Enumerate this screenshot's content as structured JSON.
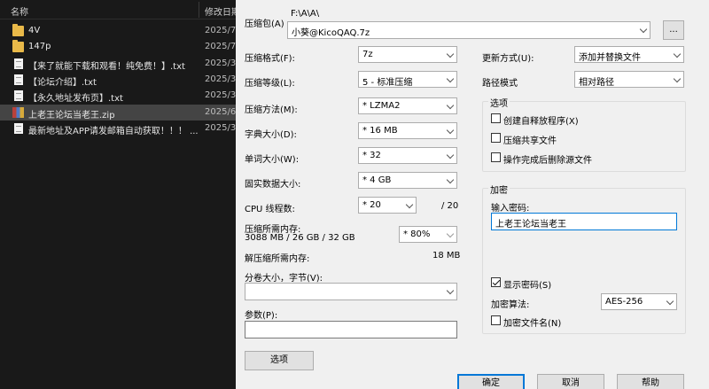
{
  "explorer": {
    "col_name": "名称",
    "col_date": "修改日期",
    "files": [
      {
        "name": "4V",
        "date": "2025/7,",
        "type": "folder",
        "selected": false
      },
      {
        "name": "147p",
        "date": "2025/7,",
        "type": "folder",
        "selected": false
      },
      {
        "name": "【来了就能下载和观看！纯免费！】.txt",
        "date": "2025/3,",
        "type": "txt",
        "selected": false
      },
      {
        "name": "【论坛介绍】.txt",
        "date": "2025/3,",
        "type": "txt",
        "selected": false
      },
      {
        "name": "【永久地址发布页】.txt",
        "date": "2025/3,",
        "type": "txt",
        "selected": false
      },
      {
        "name": "上老王论坛当老王.zip",
        "date": "2025/6,",
        "type": "zip",
        "selected": true
      },
      {
        "name": "最新地址及APP请发邮箱自动获取！！！ ...",
        "date": "2025/3,",
        "type": "txt",
        "selected": false
      }
    ]
  },
  "dialog": {
    "archive_label": "压缩包(A)",
    "archive_path": "F:\\A\\A\\",
    "archive_name": "小葵@KicoQAQ.7z",
    "browse_label": "...",
    "format_label": "压缩格式(F):",
    "format_value": "7z",
    "level_label": "压缩等级(L):",
    "level_value": "5 - 标准压缩",
    "method_label": "压缩方法(M):",
    "method_value": "* LZMA2",
    "dict_label": "字典大小(D):",
    "dict_value": "* 16 MB",
    "word_label": "单词大小(W):",
    "word_value": "* 32",
    "solid_label": "固实数据大小:",
    "solid_value": "* 4 GB",
    "cpu_label": "CPU 线程数:",
    "cpu_value": "* 20",
    "cpu_total": "/ 20",
    "mem_comp_label": "压缩所需内存:",
    "mem_comp_value": "3088 MB / 26 GB / 32 GB",
    "mem_percent": "* 80%",
    "mem_decomp_label": "解压缩所需内存:",
    "mem_decomp_value": "18 MB",
    "split_label": "分卷大小，字节(V):",
    "split_value": "",
    "params_label": "参数(P):",
    "params_value": "",
    "options_button": "选项",
    "update_label": "更新方式(U):",
    "update_value": "添加并替换文件",
    "path_label": "路径模式",
    "path_value": "相对路径",
    "options_group": "选项",
    "opt_sfx": "创建自释放程序(X)",
    "opt_shared": "压缩共享文件",
    "opt_delete": "操作完成后删除源文件",
    "encrypt_group": "加密",
    "pwd_label": "输入密码:",
    "pwd_value": "上老王论坛当老王",
    "show_pwd": "显示密码(S)",
    "enc_method_label": "加密算法:",
    "enc_method_value": "AES-256",
    "enc_names": "加密文件名(N)",
    "ok_button": "确定",
    "cancel_button": "取消",
    "help_button": "帮助"
  }
}
